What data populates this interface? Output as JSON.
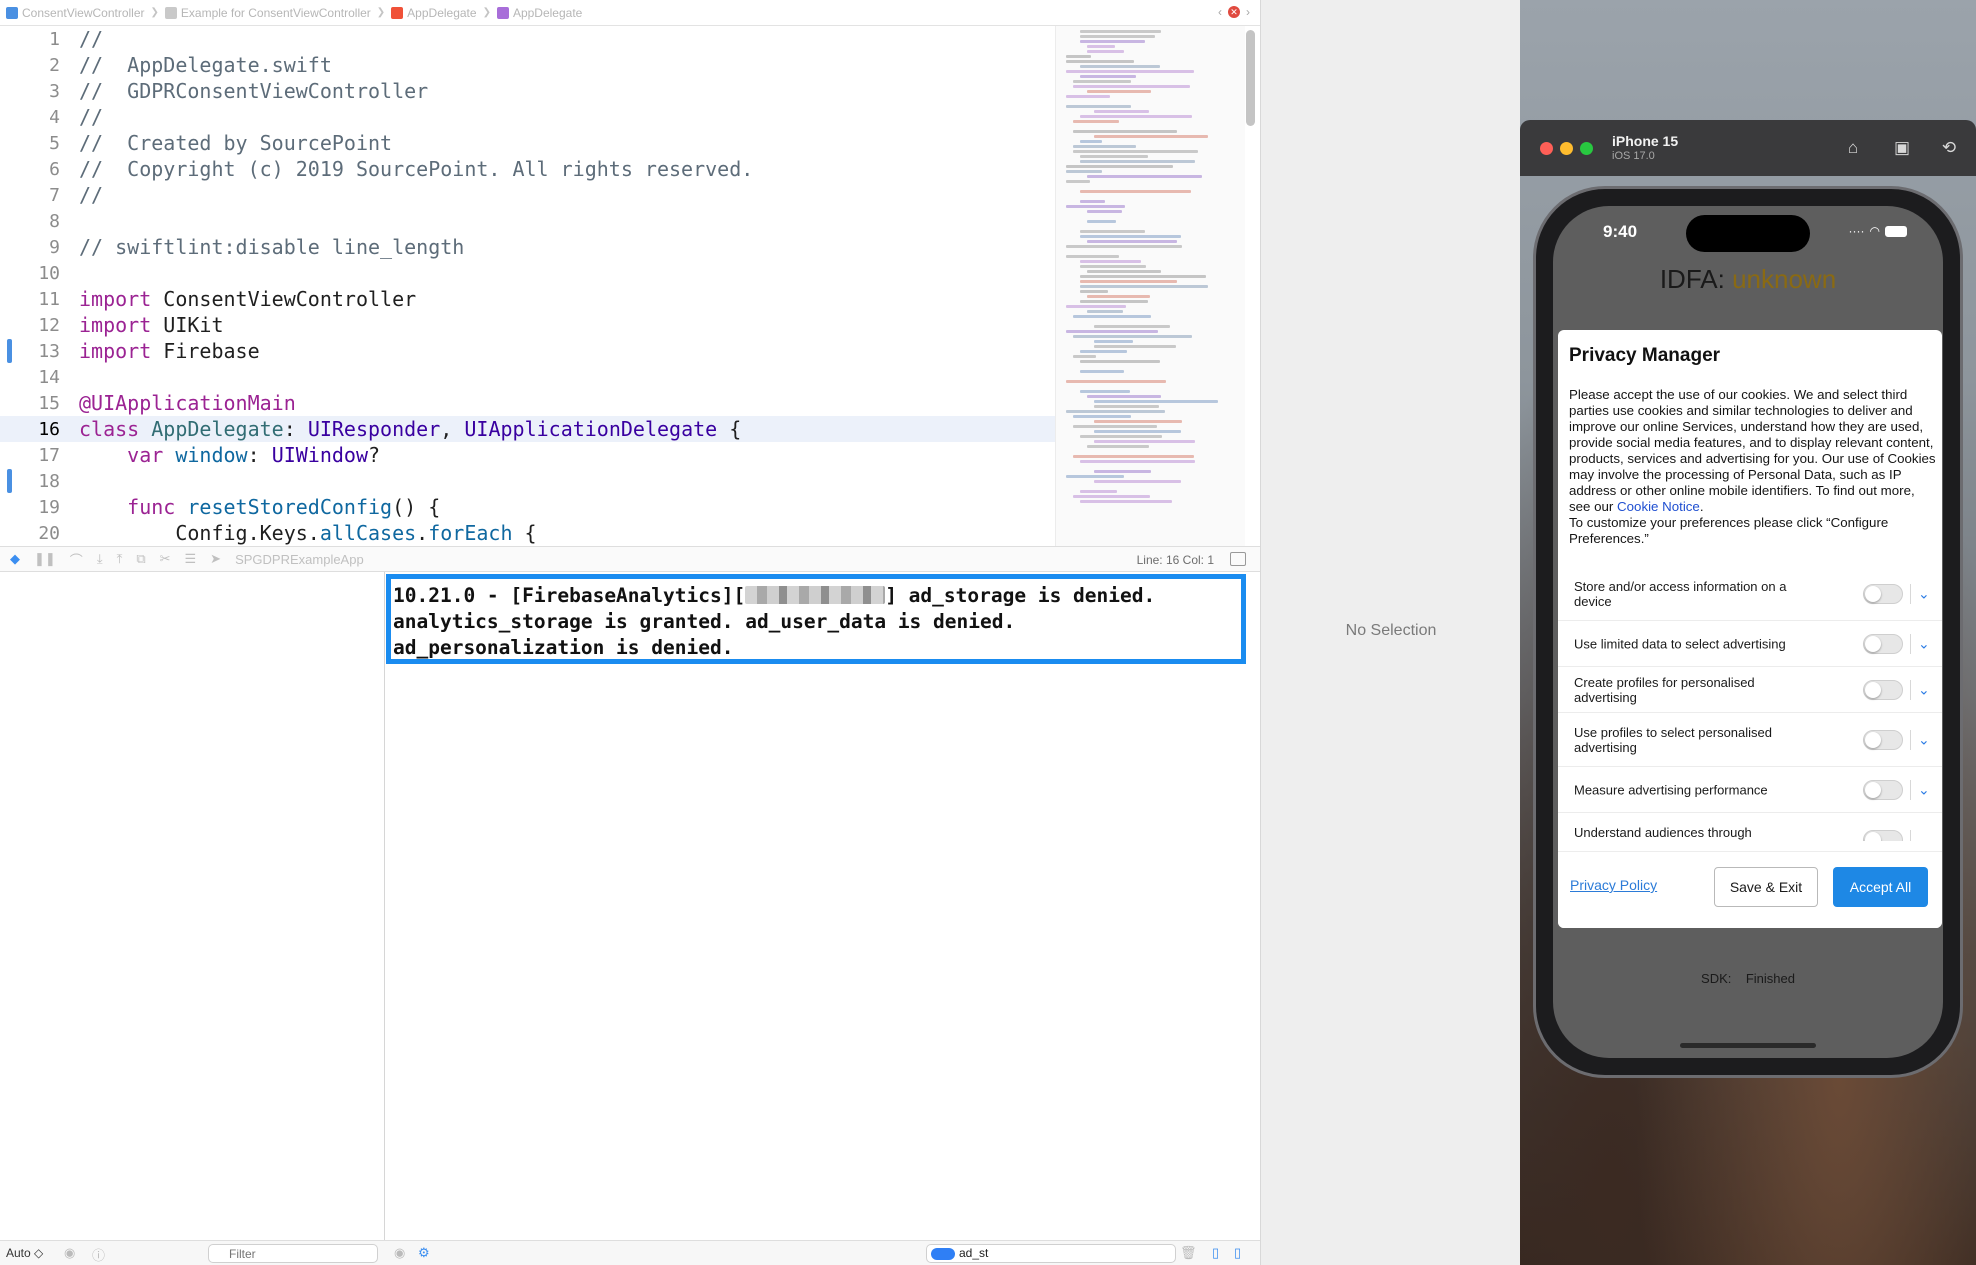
{
  "jumpbar": {
    "items": [
      {
        "label": "ConsentViewController",
        "color": "#4a90e2"
      },
      {
        "label": "Example for ConsentViewController",
        "color": "#8a8a8a"
      },
      {
        "label": "AppDelegate",
        "color": "#f05138"
      },
      {
        "label": "AppDelegate",
        "color": "#a86ed9"
      }
    ]
  },
  "editor": {
    "lines": [
      {
        "num": "1"
      },
      {
        "num": "2"
      },
      {
        "num": "3"
      },
      {
        "num": "4"
      },
      {
        "num": "5"
      },
      {
        "num": "6"
      },
      {
        "num": "7"
      },
      {
        "num": "8"
      },
      {
        "num": "9"
      },
      {
        "num": "10"
      },
      {
        "num": "11"
      },
      {
        "num": "12"
      },
      {
        "num": "13"
      },
      {
        "num": "14"
      },
      {
        "num": "15"
      },
      {
        "num": "16"
      },
      {
        "num": "17"
      },
      {
        "num": "18"
      },
      {
        "num": "19"
      },
      {
        "num": "20"
      }
    ],
    "code": {
      "l1": "//",
      "l2": "//  AppDelegate.swift",
      "l3": "//  GDPRConsentViewController",
      "l4": "//",
      "l5": "//  Created by SourcePoint",
      "l6": "//  Copyright (c) 2019 SourcePoint. All rights reserved.",
      "l7": "//",
      "l9": "// swiftlint:disable line_length",
      "import": "import",
      "l11_mod": "ConsentViewController",
      "l12_mod": "UIKit",
      "l13_mod": "Firebase",
      "l15": "@UIApplicationMain",
      "class_kw": "class",
      "class_name": "AppDelegate",
      "colon": ": ",
      "responder": "UIResponder",
      "comma": ", ",
      "delegate": "UIApplicationDelegate",
      "brace_open": " {",
      "var_kw": "var",
      "window": "window",
      "uiwindow": "UIWindow",
      "optional": "?",
      "func_kw": "func",
      "reset": "resetStoredConfig",
      "call_brace": "() {",
      "config": "Config.Keys.",
      "allcases": "allCases",
      "dot": ".",
      "foreach": "forEach"
    }
  },
  "debugbar": {
    "scheme": "SPGDPRExampleApp",
    "position": "Line: 16  Col: 1"
  },
  "console": {
    "part1": "10.21.0 - [FirebaseAnalytics][",
    "part2": "] ad_storage is denied.\nanalytics_storage is granted. ad_user_data is denied.\nad_personalization is denied."
  },
  "bottombar": {
    "auto": "Auto ◇",
    "filter_placeholder": "Filter",
    "search_value": "ad_st"
  },
  "inspector": {
    "no_selection": "No Selection"
  },
  "simulator": {
    "device": "iPhone 15",
    "os": "iOS 17.0",
    "time": "9:40",
    "idfa_label": "IDFA: ",
    "idfa_value": "unknown",
    "sdk_label": "SDK:",
    "sdk_status": "Finished"
  },
  "privacy_manager": {
    "title": "Privacy Manager",
    "desc_main": "Please accept the use of our cookies. We and select third parties use cookies and similar technologies to deliver and improve our online Services, understand how they are used, provide social media features, and to display relevant content, products, services and advertising for you. Our use of Cookies may involve the processing of Personal Data, such as IP address or other online mobile identifiers. To find out more, see our ",
    "cookie_link": "Cookie Notice",
    "desc_end": ".",
    "desc_2": "To customize your preferences please click “Configure Preferences.”",
    "purposes": [
      {
        "label": "Store and/or access information on a device",
        "enabled": false
      },
      {
        "label": "Use limited data to select advertising",
        "enabled": false
      },
      {
        "label": "Create profiles for personalised advertising",
        "enabled": false
      },
      {
        "label": "Use profiles to select personalised advertising",
        "enabled": false
      },
      {
        "label": "Measure advertising performance",
        "enabled": false
      },
      {
        "label": "Understand audiences through statistics or",
        "enabled": false
      }
    ],
    "privacy_policy": "Privacy Policy",
    "save_exit": "Save & Exit",
    "accept_all": "Accept All",
    "accent": "#1e88e5"
  }
}
